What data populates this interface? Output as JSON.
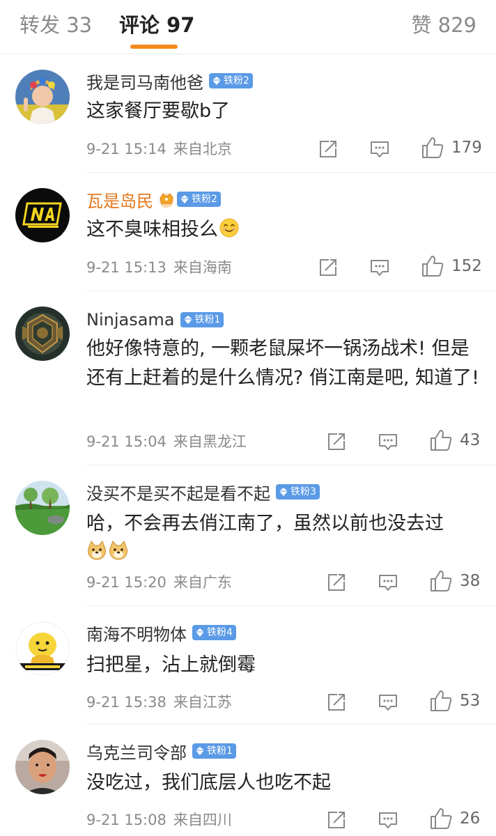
{
  "tabs": {
    "repost": "转发 33",
    "comment": "评论 97",
    "like": "赞 829",
    "underline_color": "#f58a1f"
  },
  "comments": [
    {
      "user": "我是司马南他爸",
      "badge": "铁粉2",
      "text": "这家餐厅要歇b了",
      "time": "9-21 15:14",
      "source": "来自北京",
      "likes": "179",
      "avatar_icon": "avatar-woman-flower-crown"
    },
    {
      "user": "瓦是岛民",
      "badge": "铁粉2",
      "text": "这不臭味相投么",
      "emoji": "smile-emoji",
      "time": "9-21 15:13",
      "source": "来自海南",
      "likes": "152",
      "avatar_icon": "avatar-navi-logo",
      "name_color": "#e5791f",
      "crown_icon": "crown-icon"
    },
    {
      "user": "Ninjasama",
      "badge": "铁粉1",
      "text": "他好像特意的, 一颗老鼠屎坏一锅汤战术! 但是还有上赶着的是什么情况? 俏江南是吧, 知道了!",
      "time": "9-21 15:04",
      "source": "来自黑龙江",
      "likes": "43",
      "avatar_icon": "avatar-emblem"
    },
    {
      "user": "没买不是买不起是看不起",
      "badge": "铁粉3",
      "text": "哈，不会再去俏江南了，虽然以前也没去过",
      "emojis": [
        "doge-emoji",
        "doge-emoji"
      ],
      "time": "9-21 15:20",
      "source": "来自广东",
      "likes": "38",
      "avatar_icon": "avatar-landscape"
    },
    {
      "user": "南海不明物体",
      "badge": "铁粉4",
      "text": "扫把星，沾上就倒霉",
      "time": "9-21 15:38",
      "source": "来自江苏",
      "likes": "53",
      "avatar_icon": "avatar-cartoon-yellow"
    },
    {
      "user": "乌克兰司令部",
      "badge": "铁粉1",
      "text": "没吃过，我们底层人也吃不起",
      "time": "9-21 15:08",
      "source": "来自四川",
      "likes": "26",
      "avatar_icon": "avatar-man-photo"
    }
  ],
  "colors": {
    "badge_blue": "#5a9ae6",
    "meta_gray": "#8a8a8a",
    "vip_name": "#e5791f"
  }
}
